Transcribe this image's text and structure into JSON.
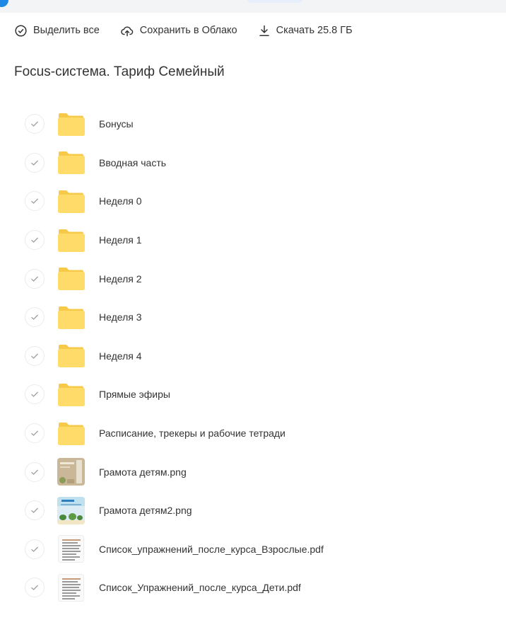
{
  "toolbar": {
    "select_all_label": "Выделить все",
    "save_cloud_label": "Сохранить в Облако",
    "download_label": "Скачать 25.8 ГБ"
  },
  "folder": {
    "title": "Focus-система. Тариф Семейный"
  },
  "colors": {
    "folder_yellow": "#ffdb6a",
    "folder_tab": "#f7c948",
    "accent_blue": "#1e88e5"
  },
  "items": [
    {
      "name": "Бонусы",
      "type": "folder",
      "icon": "folder-icon"
    },
    {
      "name": "Вводная часть",
      "type": "folder",
      "icon": "folder-icon"
    },
    {
      "name": "Неделя 0",
      "type": "folder",
      "icon": "folder-icon"
    },
    {
      "name": "Неделя 1",
      "type": "folder",
      "icon": "folder-icon"
    },
    {
      "name": "Неделя 2",
      "type": "folder",
      "icon": "folder-icon"
    },
    {
      "name": "Неделя 3",
      "type": "folder",
      "icon": "folder-icon"
    },
    {
      "name": "Неделя 4",
      "type": "folder",
      "icon": "folder-icon"
    },
    {
      "name": "Прямые эфиры",
      "type": "folder",
      "icon": "folder-icon"
    },
    {
      "name": "Расписание, трекеры и рабочие тетради",
      "type": "folder",
      "icon": "folder-icon"
    },
    {
      "name": "Грамота детям.png",
      "type": "image",
      "icon": "image-thumbnail",
      "variant": "beige"
    },
    {
      "name": "Грамота детям2.png",
      "type": "image",
      "icon": "image-thumbnail",
      "variant": "blue"
    },
    {
      "name": "Список_упражнений_после_курса_Взрослые.pdf",
      "type": "pdf",
      "icon": "pdf-thumbnail"
    },
    {
      "name": "Список_Упражнений_после_курса_Дети.pdf",
      "type": "pdf",
      "icon": "pdf-thumbnail"
    }
  ]
}
